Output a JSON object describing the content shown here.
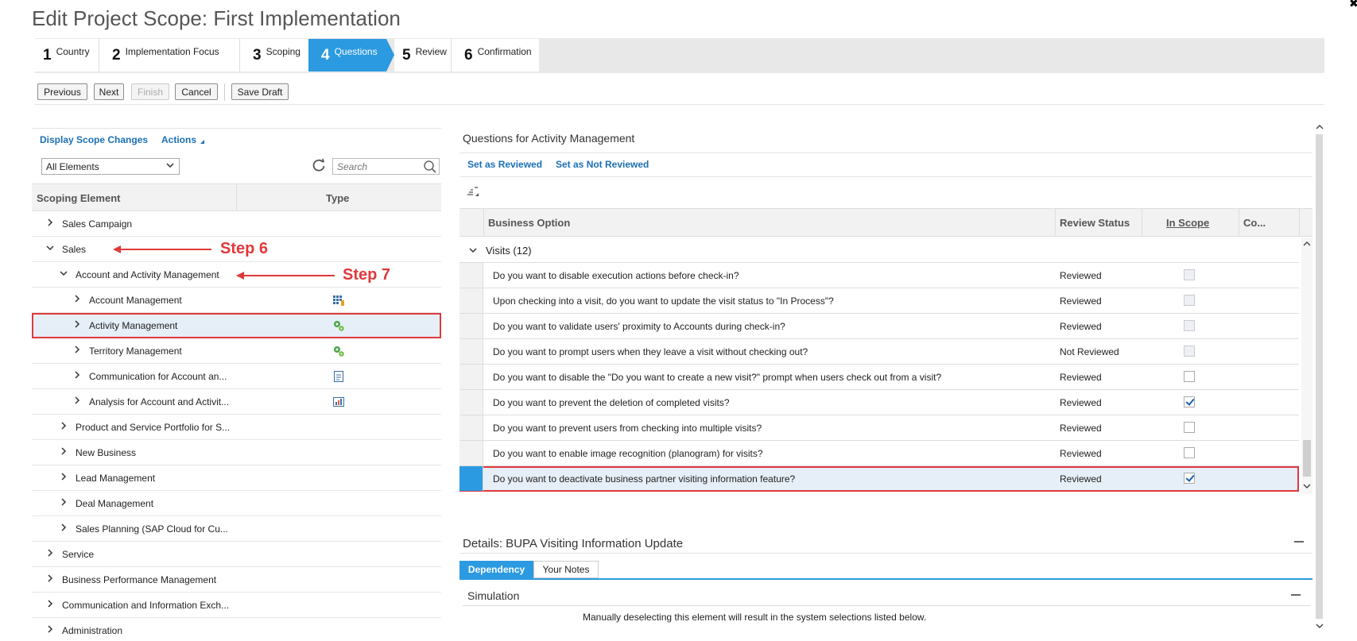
{
  "page": {
    "title": "Edit Project Scope: First Implementation"
  },
  "wizard": {
    "steps": [
      {
        "num": "1",
        "label": "Country"
      },
      {
        "num": "2",
        "label": "Implementation Focus"
      },
      {
        "num": "3",
        "label": "Scoping"
      },
      {
        "num": "4",
        "label": "Questions"
      },
      {
        "num": "5",
        "label": "Review"
      },
      {
        "num": "6",
        "label": "Confirmation"
      }
    ],
    "active_step": 4
  },
  "toolbar": {
    "previous": "Previous",
    "next": "Next",
    "finish": "Finish",
    "cancel": "Cancel",
    "save_draft": "Save Draft"
  },
  "left": {
    "display_scope_changes": "Display Scope Changes",
    "actions": "Actions",
    "filter_value": "All Elements",
    "search_placeholder": "Search",
    "col_element": "Scoping Element",
    "col_type": "Type",
    "tree": [
      {
        "label": "Sales Campaign",
        "level": 0,
        "state": "collapsed",
        "type_icon": ""
      },
      {
        "label": "Sales",
        "level": 0,
        "state": "expanded",
        "type_icon": ""
      },
      {
        "label": "Account and Activity Management",
        "level": 1,
        "state": "expanded",
        "type_icon": ""
      },
      {
        "label": "Account Management",
        "level": 2,
        "state": "collapsed",
        "type_icon": "table-icon"
      },
      {
        "label": "Activity Management",
        "level": 2,
        "state": "collapsed",
        "type_icon": "gears-icon"
      },
      {
        "label": "Territory Management",
        "level": 2,
        "state": "collapsed",
        "type_icon": "gears-icon"
      },
      {
        "label": "Communication for Account an...",
        "level": 2,
        "state": "collapsed",
        "type_icon": "document-icon"
      },
      {
        "label": "Analysis for Account and Activit...",
        "level": 2,
        "state": "collapsed",
        "type_icon": "chart-icon"
      },
      {
        "label": "Product and Service Portfolio for S...",
        "level": 1,
        "state": "collapsed",
        "type_icon": ""
      },
      {
        "label": "New Business",
        "level": 1,
        "state": "collapsed",
        "type_icon": ""
      },
      {
        "label": "Lead Management",
        "level": 1,
        "state": "collapsed",
        "type_icon": ""
      },
      {
        "label": "Deal Management",
        "level": 1,
        "state": "collapsed",
        "type_icon": ""
      },
      {
        "label": "Sales Planning (SAP Cloud for Cu...",
        "level": 1,
        "state": "collapsed",
        "type_icon": ""
      },
      {
        "label": "Service",
        "level": 0,
        "state": "collapsed",
        "type_icon": ""
      },
      {
        "label": "Business Performance Management",
        "level": 0,
        "state": "collapsed",
        "type_icon": ""
      },
      {
        "label": "Communication and Information Exch...",
        "level": 0,
        "state": "collapsed",
        "type_icon": ""
      },
      {
        "label": "Administration",
        "level": 0,
        "state": "collapsed",
        "type_icon": ""
      }
    ],
    "selected_index": 4
  },
  "annotations": {
    "step6": "Step 6",
    "step7": "Step 7",
    "color": "#e0393b"
  },
  "right": {
    "title": "Questions for Activity Management",
    "set_reviewed": "Set as Reviewed",
    "set_not_reviewed": "Set as Not Reviewed",
    "col_option": "Business Option",
    "col_status": "Review Status",
    "col_scope": "In Scope",
    "col_co": "Co...",
    "group": "Visits (12)",
    "rows": [
      {
        "q": "Do you want to disable execution actions before check-in?",
        "status": "Reviewed",
        "checked": false,
        "disabled": true
      },
      {
        "q": "Upon checking into a visit, do you want to update the visit status to \"In Process\"?",
        "status": "Reviewed",
        "checked": false,
        "disabled": true
      },
      {
        "q": "Do you want to validate users' proximity to Accounts during check-in?",
        "status": "Reviewed",
        "checked": false,
        "disabled": true
      },
      {
        "q": "Do you want to prompt users when they leave a visit without checking out?",
        "status": "Not Reviewed",
        "checked": false,
        "disabled": true
      },
      {
        "q": "Do you want to disable the \"Do you want to create a new visit?\" prompt when users check out from a visit?",
        "status": "Reviewed",
        "checked": false,
        "disabled": false
      },
      {
        "q": "Do you want to prevent the deletion of completed visits?",
        "status": "Reviewed",
        "checked": true,
        "disabled": false
      },
      {
        "q": "Do you want to prevent users from checking into multiple visits?",
        "status": "Reviewed",
        "checked": false,
        "disabled": false
      },
      {
        "q": "Do you want to enable image recognition (planogram) for visits?",
        "status": "Reviewed",
        "checked": false,
        "disabled": false
      },
      {
        "q": "Do you want to deactivate business partner visiting information feature?",
        "status": "Reviewed",
        "checked": true,
        "disabled": false
      }
    ],
    "selected_index": 8
  },
  "details": {
    "title": "Details: BUPA Visiting Information Update",
    "tab_dependency": "Dependency",
    "tab_notes": "Your Notes",
    "simulation": "Simulation",
    "simulation_text": "Manually deselecting this element will result in the system selections listed below."
  },
  "colors": {
    "accent": "#2b9ae0",
    "link": "#1a6fb5",
    "highlight": "#e0393b"
  }
}
